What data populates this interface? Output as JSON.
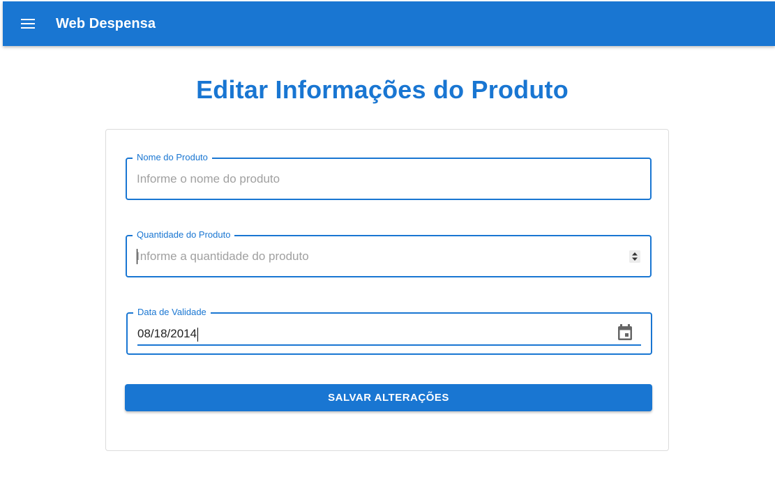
{
  "appbar": {
    "title": "Web Despensa",
    "menu_icon": "menu-icon",
    "color": "#1976d2"
  },
  "page": {
    "title": "Editar Informações do Produto"
  },
  "form": {
    "product_name": {
      "label": "Nome do Produto",
      "placeholder": "Informe o nome do produto",
      "value": ""
    },
    "product_quantity": {
      "label": "Quantidade do Produto",
      "placeholder": "Informe a quantidade do produto",
      "value": "",
      "stepper_icon": "spin-arrows-icon"
    },
    "expiry_date": {
      "label": "Data de Validade",
      "value": "08/18/2014",
      "calendar_icon": "calendar-icon"
    },
    "submit_label": "SALVAR ALTERAÇÕES"
  }
}
